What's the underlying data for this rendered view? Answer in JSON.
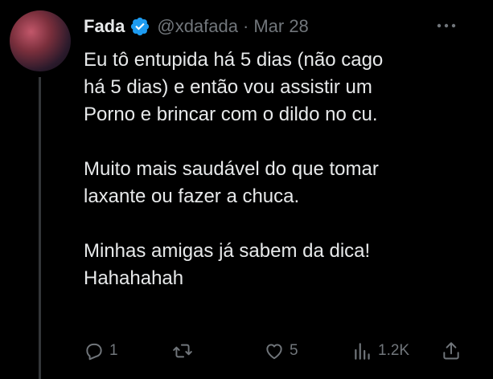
{
  "tweet": {
    "display_name": "Fada",
    "handle": "@xdafada",
    "separator": "·",
    "date": "Mar 28",
    "paragraphs": [
      "Eu tô entupida há 5 dias (não cago\nhá 5 dias) e então vou assistir um\nPorno e brincar com o dildo no cu.",
      "Muito mais saudável do que tomar\nlaxante ou fazer a chuca.",
      "Minhas amigas já sabem da dica!\nHahahahah"
    ]
  },
  "actions": {
    "reply_count": "1",
    "like_count": "5",
    "views_count": "1.2K"
  },
  "icons": [
    "verified-badge-icon",
    "more-icon",
    "reply-icon",
    "retweet-icon",
    "like-icon",
    "views-icon",
    "share-icon"
  ],
  "colors": {
    "background": "#000000",
    "text": "#e7e9ea",
    "muted": "#71767b",
    "verified": "#1d9bf0"
  }
}
